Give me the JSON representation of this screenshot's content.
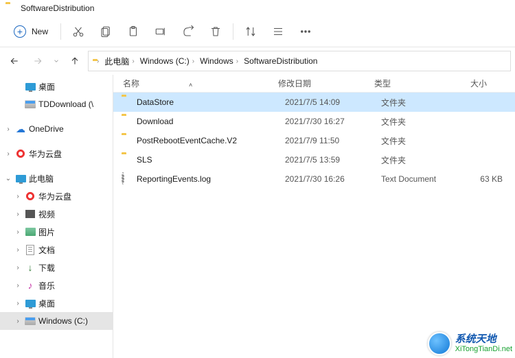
{
  "window": {
    "title": "SoftwareDistribution"
  },
  "toolbar": {
    "new_label": "New"
  },
  "breadcrumb": {
    "items": [
      "此电脑",
      "Windows (C:)",
      "Windows",
      "SoftwareDistribution"
    ]
  },
  "sidebar": {
    "items": [
      {
        "label": "桌面",
        "icon": "monitor",
        "level": 1,
        "twisty": ""
      },
      {
        "label": "TDDownload (\\",
        "icon": "disk",
        "level": 1,
        "twisty": ""
      },
      {
        "label": "OneDrive",
        "icon": "cloud",
        "level": 0,
        "twisty": "right"
      },
      {
        "label": "华为云盘",
        "icon": "hw",
        "level": 0,
        "twisty": "right"
      },
      {
        "label": "此电脑",
        "icon": "monitor",
        "level": 0,
        "twisty": "down"
      },
      {
        "label": "华为云盘",
        "icon": "hw",
        "level": 1,
        "twisty": "right"
      },
      {
        "label": "视频",
        "icon": "video",
        "level": 1,
        "twisty": "right"
      },
      {
        "label": "图片",
        "icon": "image",
        "level": 1,
        "twisty": "right"
      },
      {
        "label": "文档",
        "icon": "doc",
        "level": 1,
        "twisty": "right"
      },
      {
        "label": "下载",
        "icon": "download",
        "level": 1,
        "twisty": "right"
      },
      {
        "label": "音乐",
        "icon": "music",
        "level": 1,
        "twisty": "right"
      },
      {
        "label": "桌面",
        "icon": "monitor",
        "level": 1,
        "twisty": "right"
      },
      {
        "label": "Windows (C:)",
        "icon": "disk",
        "level": 1,
        "twisty": "right",
        "selected": true
      }
    ]
  },
  "columns": {
    "name": "名称",
    "date": "修改日期",
    "type": "类型",
    "size": "大小"
  },
  "files": [
    {
      "name": "DataStore",
      "date": "2021/7/5 14:09",
      "type": "文件夹",
      "size": "",
      "icon": "folder",
      "selected": true
    },
    {
      "name": "Download",
      "date": "2021/7/30 16:27",
      "type": "文件夹",
      "size": "",
      "icon": "folder"
    },
    {
      "name": "PostRebootEventCache.V2",
      "date": "2021/7/9 11:50",
      "type": "文件夹",
      "size": "",
      "icon": "folder"
    },
    {
      "name": "SLS",
      "date": "2021/7/5 13:59",
      "type": "文件夹",
      "size": "",
      "icon": "folder"
    },
    {
      "name": "ReportingEvents.log",
      "date": "2021/7/30 16:26",
      "type": "Text Document",
      "size": "63 KB",
      "icon": "gear"
    }
  ],
  "watermark": {
    "title": "系统天地",
    "url": "XiTongTianDi.net"
  }
}
